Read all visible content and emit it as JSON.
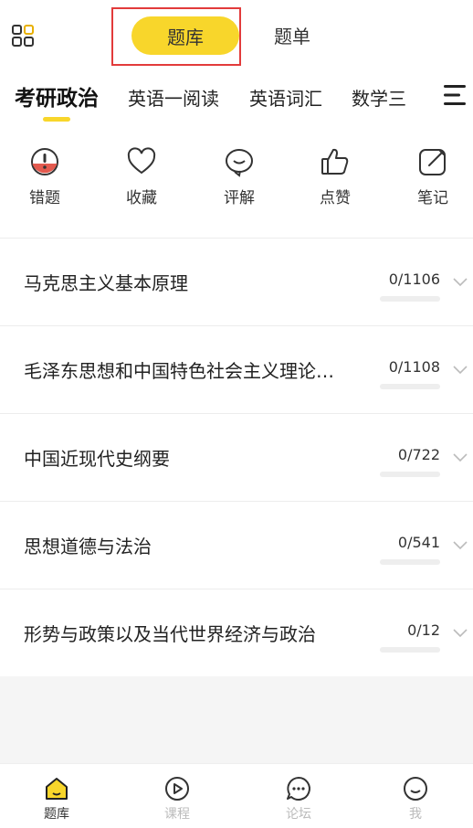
{
  "header": {
    "tabs": [
      {
        "label": "题库",
        "active": true
      },
      {
        "label": "题单",
        "active": false
      }
    ]
  },
  "categories": [
    {
      "label": "考研政治",
      "active": true
    },
    {
      "label": "英语一阅读",
      "active": false
    },
    {
      "label": "英语词汇",
      "active": false
    },
    {
      "label": "数学三",
      "active": false
    }
  ],
  "actions": [
    {
      "label": "错题",
      "icon": "exclamation-icon"
    },
    {
      "label": "收藏",
      "icon": "heart-icon"
    },
    {
      "label": "评解",
      "icon": "comment-icon"
    },
    {
      "label": "点赞",
      "icon": "thumbs-up-icon"
    },
    {
      "label": "笔记",
      "icon": "edit-icon"
    }
  ],
  "subjects": [
    {
      "title": "马克思主义基本原理",
      "progress": "0/1106"
    },
    {
      "title": "毛泽东思想和中国特色社会主义理论…",
      "progress": "0/1108"
    },
    {
      "title": "中国近现代史纲要",
      "progress": "0/722"
    },
    {
      "title": "思想道德与法治",
      "progress": "0/541"
    },
    {
      "title": "形势与政策以及当代世界经济与政治",
      "progress": "0/12"
    }
  ],
  "bottom_nav": [
    {
      "label": "题库",
      "icon": "home-icon",
      "active": true
    },
    {
      "label": "课程",
      "icon": "play-icon",
      "active": false
    },
    {
      "label": "论坛",
      "icon": "chat-icon",
      "active": false
    },
    {
      "label": "我",
      "icon": "smile-icon",
      "active": false
    }
  ],
  "colors": {
    "accent": "#f8d62b",
    "highlight_border": "#e23b3b",
    "error_icon": "#e35a4f"
  }
}
